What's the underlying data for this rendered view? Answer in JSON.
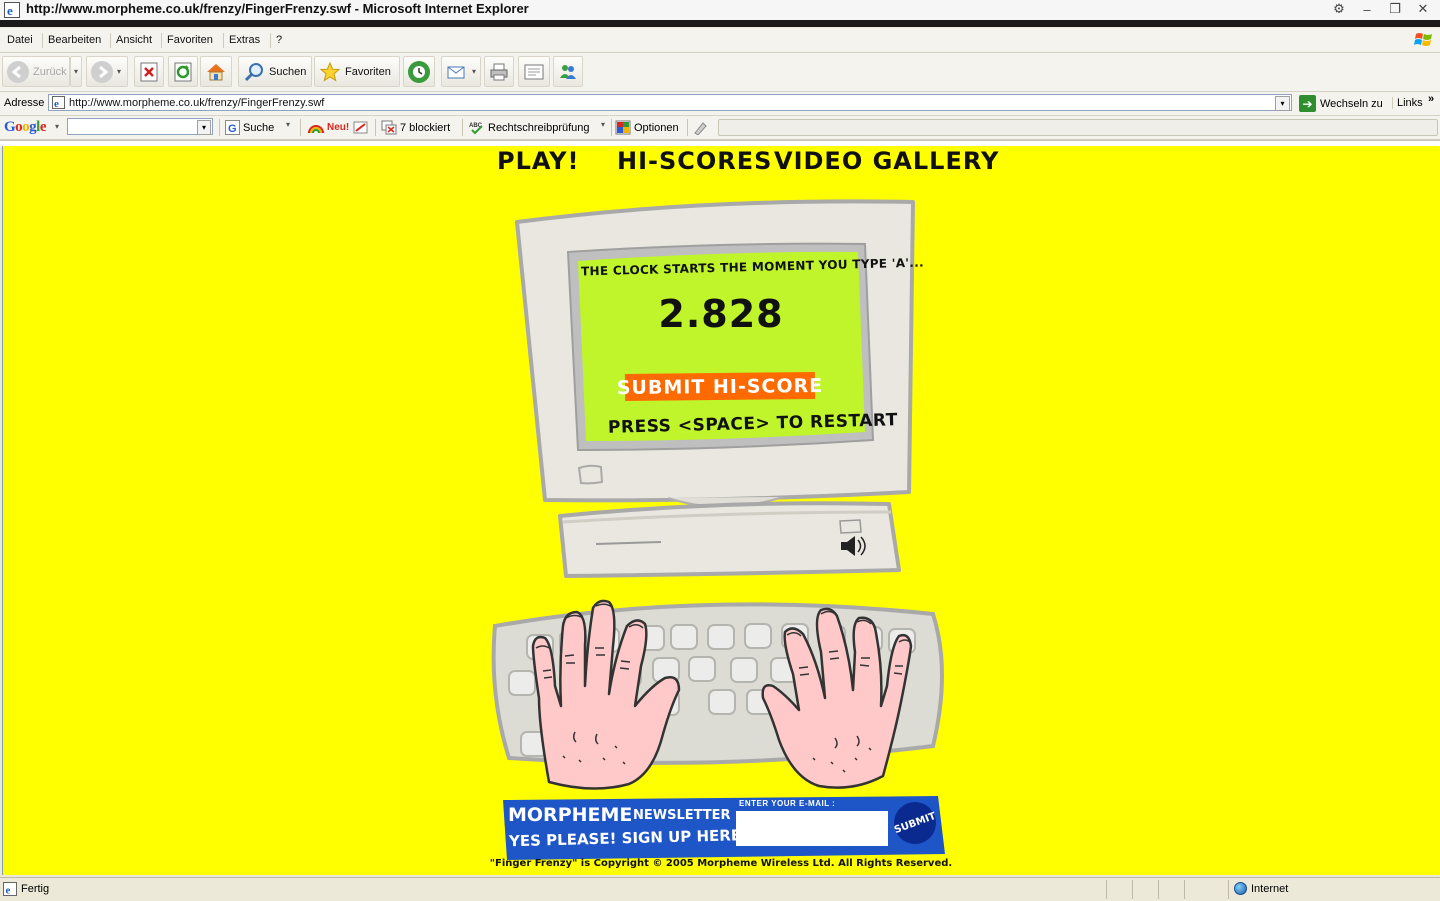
{
  "window": {
    "title": "http://www.morpheme.co.uk/frenzy/FingerFrenzy.swf - Microsoft Internet Explorer"
  },
  "menu": [
    "Datei",
    "Bearbeiten",
    "Ansicht",
    "Favoriten",
    "Extras",
    "?"
  ],
  "toolbar": {
    "back": "Zurück",
    "search": "Suchen",
    "favorites": "Favoriten"
  },
  "address": {
    "label": "Adresse",
    "url": "http://www.morpheme.co.uk/frenzy/FingerFrenzy.swf",
    "go": "Wechseln zu",
    "links": "Links",
    "more": "»"
  },
  "google_toolbar": {
    "logo": "Google",
    "search": "Suche",
    "new": "Neu!",
    "blocked": "7 blockiert",
    "spellcheck": "Rechtschreibprüfung",
    "options": "Optionen"
  },
  "game": {
    "nav": [
      "PLAY!",
      "HI-SCORES",
      "VIDEO GALLERY"
    ],
    "clock_text": "THE CLOCK STARTS THE MOMENT YOU TYPE 'A'...",
    "time": "2.828",
    "submit": "SUBMIT HI-SCORE",
    "restart": "PRESS <SPACE> TO RESTART",
    "newsletter": {
      "brand": "MORPHEME",
      "sub": "NEWSLETTER",
      "yes": "YES PLEASE! SIGN UP HERE...",
      "email_label": "ENTER YOUR E-MAIL :",
      "email_value": "",
      "submit": "SUBMIT"
    },
    "copyright": "\"Finger Frenzy\" is Copyright © 2005 Morpheme Wireless Ltd. All Rights Reserved."
  },
  "status": {
    "text": "Fertig",
    "zone": "Internet"
  },
  "colors": {
    "page_bg": "#ffff00",
    "screen": "#bff52a",
    "submit": "#ff6a00",
    "newsletter": "#1e56c8"
  }
}
